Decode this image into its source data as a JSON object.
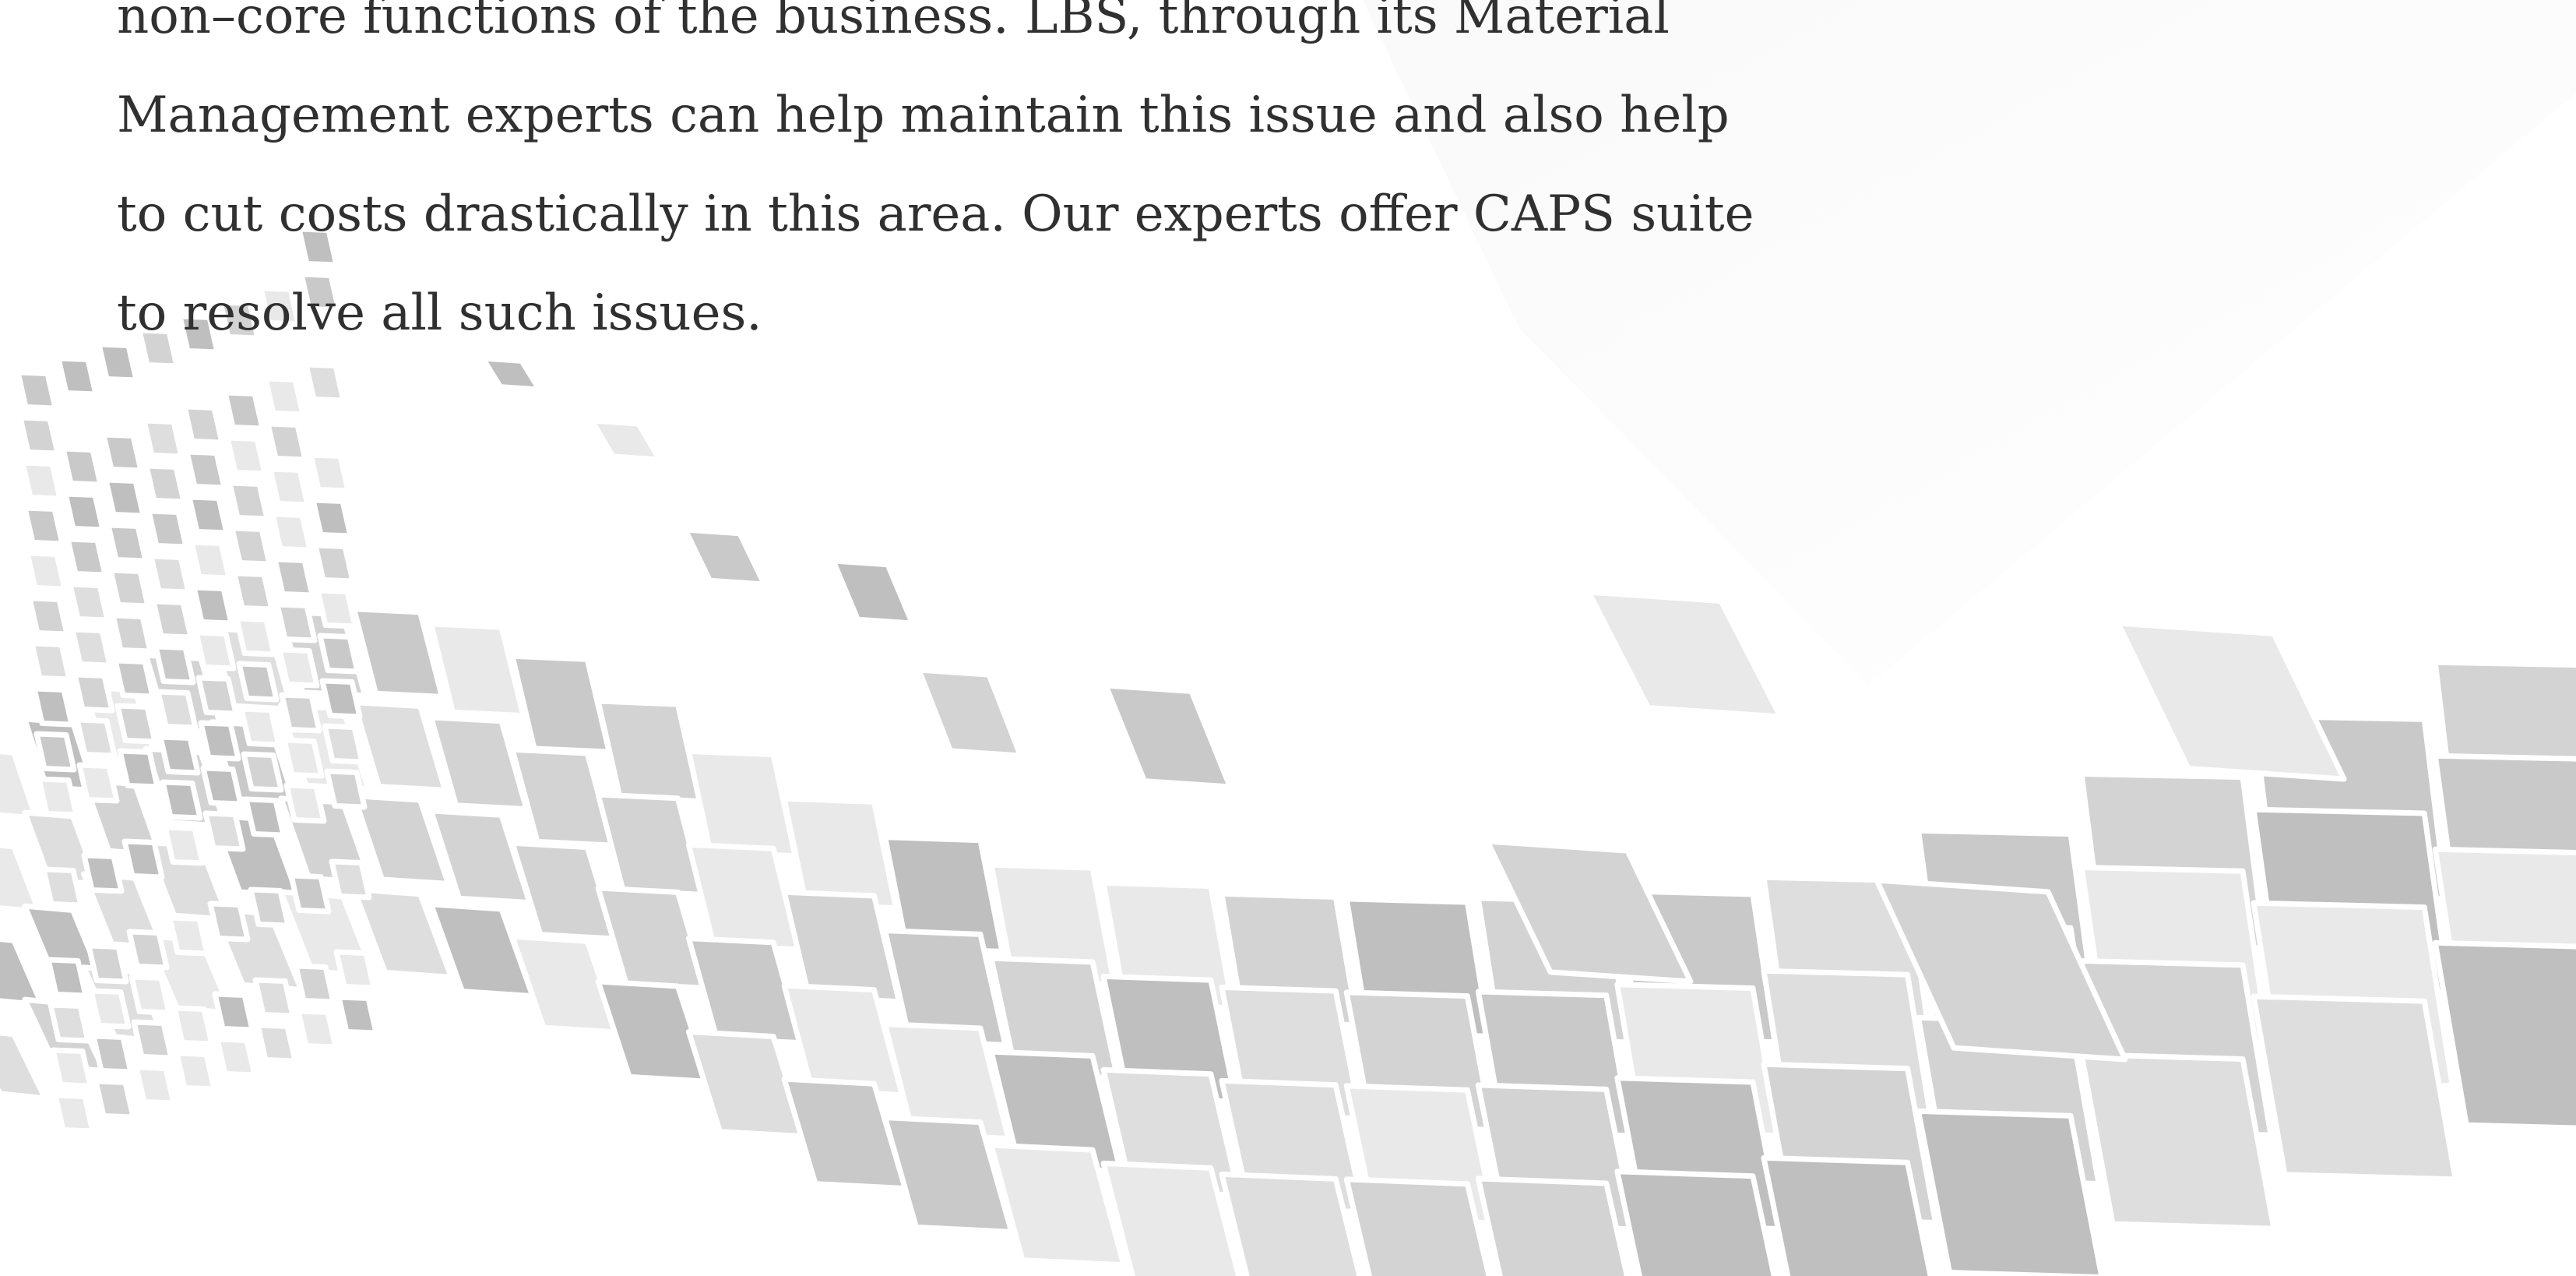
{
  "document": {
    "paragraph_lines": [
      "non–core functions of the business. LBS, through its Material",
      "Management experts can help maintain this issue and also help",
      "to cut costs drastically in this area. Our experts offer CAPS suite",
      "to resolve all such issues."
    ]
  },
  "colors": {
    "text": "#303030",
    "background": "#ffffff",
    "tile_light": "#ebebeb",
    "tile_mid": "#d2d2d2",
    "tile_dark": "#bdbdbd"
  }
}
